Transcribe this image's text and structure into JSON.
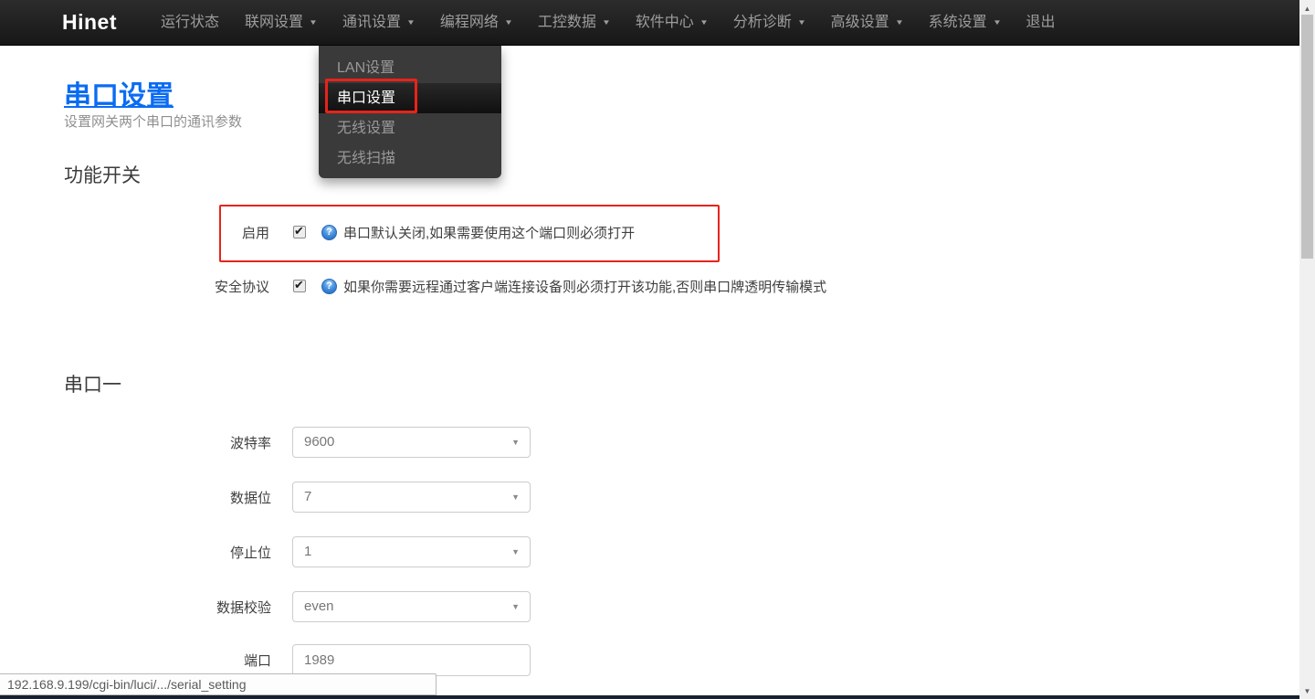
{
  "navbar": {
    "brand": "Hinet",
    "items": [
      {
        "label": "运行状态",
        "caret": false
      },
      {
        "label": "联网设置",
        "caret": true
      },
      {
        "label": "通讯设置",
        "caret": true
      },
      {
        "label": "编程网络",
        "caret": true
      },
      {
        "label": "工控数据",
        "caret": true
      },
      {
        "label": "软件中心",
        "caret": true
      },
      {
        "label": "分析诊断",
        "caret": true
      },
      {
        "label": "高级设置",
        "caret": true
      },
      {
        "label": "系统设置",
        "caret": true
      },
      {
        "label": "退出",
        "caret": false
      }
    ]
  },
  "dropdown": {
    "parent": "通讯设置",
    "items": [
      {
        "label": "LAN设置",
        "highlighted": false
      },
      {
        "label": "串口设置",
        "highlighted": true,
        "annotated": true
      },
      {
        "label": "无线设置",
        "highlighted": false
      },
      {
        "label": "无线扫描",
        "highlighted": false
      }
    ]
  },
  "page": {
    "title": "串口设置",
    "subtitle": "设置网关两个串口的通讯参数"
  },
  "feature_switch": {
    "heading": "功能开关",
    "rows": [
      {
        "label": "启用",
        "checked": true,
        "help_icon": "question-icon",
        "description": "串口默认关闭,如果需要使用这个端口则必须打开",
        "annotated": true
      },
      {
        "label": "安全协议",
        "checked": true,
        "help_icon": "question-icon",
        "description": "如果你需要远程通过客户端连接设备则必须打开该功能,否则串口牌透明传输模式",
        "annotated": false
      }
    ]
  },
  "serial_one": {
    "heading": "串口一",
    "fields": [
      {
        "label": "波特率",
        "type": "select",
        "value": "9600"
      },
      {
        "label": "数据位",
        "type": "select",
        "value": "7"
      },
      {
        "label": "停止位",
        "type": "select",
        "value": "1"
      },
      {
        "label": "数据校验",
        "type": "select",
        "value": "even"
      },
      {
        "label": "端口",
        "type": "text",
        "value": "1989"
      }
    ]
  },
  "status_bar": {
    "url": "192.168.9.199/cgi-bin/luci/.../serial_setting"
  },
  "colors": {
    "title_blue": "#0b6cf3",
    "annotation_red": "#e8231a",
    "navbar_bg": "#222222",
    "dropdown_bg": "#3a3a3a",
    "help_icon_blue": "#2f7ad1"
  }
}
